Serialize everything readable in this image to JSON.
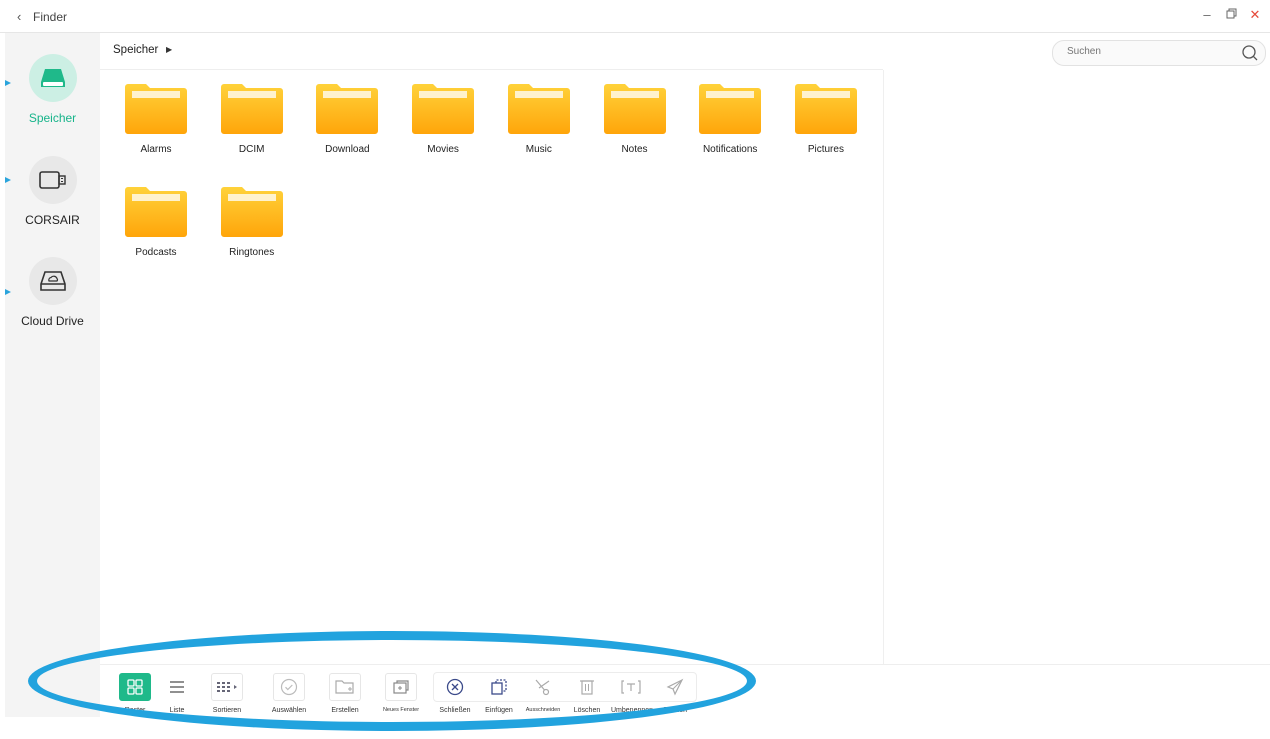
{
  "window": {
    "back_icon": "chevron-left-icon",
    "title": "Finder",
    "controls": [
      "minimize-icon",
      "restore-icon",
      "close-icon"
    ],
    "close_color": "#e64a3b"
  },
  "sidebar": {
    "items": [
      {
        "label": "Speicher",
        "icon": "storage-drive-icon",
        "active": true
      },
      {
        "label": "CORSAIR",
        "icon": "usb-drive-icon",
        "active": false
      },
      {
        "label": "Cloud Drive",
        "icon": "cloud-drive-icon",
        "active": false
      }
    ],
    "accent": "#16b48a"
  },
  "path": {
    "crumb": "Speicher",
    "arrow": "▶"
  },
  "search": {
    "placeholder": "Suchen"
  },
  "folders": [
    "Alarms",
    "DCIM",
    "Download",
    "Movies",
    "Music",
    "Notes",
    "Notifications",
    "Pictures",
    "Podcasts",
    "Ringtones"
  ],
  "toolbar": {
    "raster": "Raster",
    "liste": "Liste",
    "sortieren": "Sortieren",
    "auswaehlen": "Auswählen",
    "erstellen": "Erstellen",
    "neues_fenster": "Neues Fenster",
    "schliessen": "Schließen",
    "einfuegen": "Einfügen",
    "ausschneiden": "Ausschneiden",
    "loeschen": "Löschen",
    "umbenennen": "Umbenennen",
    "senden": "Senden"
  },
  "annotation_color": "#22a3de"
}
